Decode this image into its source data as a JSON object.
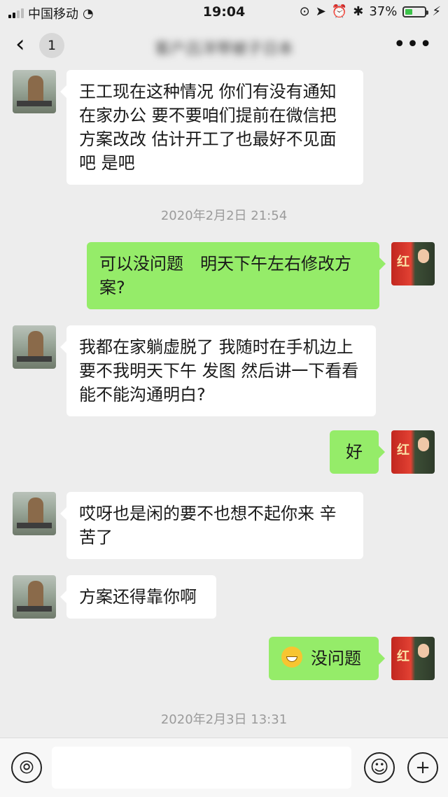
{
  "status_bar": {
    "carrier": "中国移动",
    "time": "19:04",
    "battery": "37%",
    "battery_level": 0.37
  },
  "nav": {
    "unread_count": "1",
    "title": "客户吕洋带被子日本"
  },
  "messages": [
    {
      "side": "them",
      "text": "王工现在这种情况 你们有没有通知在家办公 要不要咱们提前在微信把方案改改 估计开工了也最好不见面吧 是吧"
    },
    {
      "timestamp": "2020年2月2日 21:54"
    },
    {
      "side": "me",
      "text": "可以没问题　明天下午左右修改方案?"
    },
    {
      "side": "them",
      "text": "我都在家躺虚脱了 我随时在手机边上 要不我明天下午 发图 然后讲一下看看能不能沟通明白?"
    },
    {
      "side": "me",
      "text": "好"
    },
    {
      "side": "them",
      "text": "哎呀也是闲的要不也想不起你来 辛苦了"
    },
    {
      "side": "them",
      "text": "方案还得靠你啊"
    },
    {
      "side": "me",
      "text": "没问题",
      "emoji": "grin-emoji"
    },
    {
      "timestamp": "2020年2月3日 13:31"
    }
  ],
  "avatar_me_text": "红",
  "input": {
    "placeholder": ""
  },
  "icons": [
    "back-arrow-icon",
    "more-icon",
    "voice-icon",
    "emoji-icon",
    "plus-icon",
    "wifi-icon",
    "bluetooth-icon",
    "location-icon",
    "alarm-icon",
    "lock-rotation-icon",
    "charging-icon"
  ]
}
